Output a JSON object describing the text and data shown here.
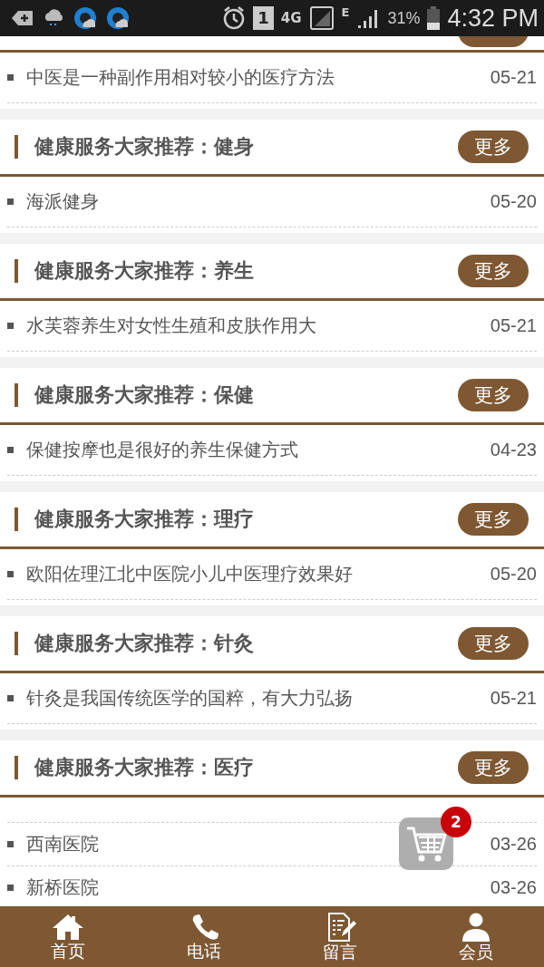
{
  "status_bar": {
    "sim": "1",
    "network": "4G",
    "roaming": "E",
    "battery": "31%",
    "time": "4:32 PM"
  },
  "top_items": [
    {
      "title": "中医是一种副作用相对较小的医疗方法",
      "date": "05-21"
    }
  ],
  "sections": [
    {
      "title": "健康服务大家推荐：健身",
      "more": "更多",
      "leading_blank": false,
      "items": [
        {
          "title": "海派健身",
          "date": "05-20"
        }
      ]
    },
    {
      "title": "健康服务大家推荐：养生",
      "more": "更多",
      "leading_blank": false,
      "items": [
        {
          "title": "水芙蓉养生对女性生殖和皮肤作用大",
          "date": "05-21"
        }
      ]
    },
    {
      "title": "健康服务大家推荐：保健",
      "more": "更多",
      "leading_blank": false,
      "items": [
        {
          "title": "保健按摩也是很好的养生保健方式",
          "date": "04-23"
        }
      ]
    },
    {
      "title": "健康服务大家推荐：理疗",
      "more": "更多",
      "leading_blank": false,
      "items": [
        {
          "title": "欧阳佐理江北中医院小儿中医理疗效果好",
          "date": "05-20"
        }
      ]
    },
    {
      "title": "健康服务大家推荐：针灸",
      "more": "更多",
      "leading_blank": false,
      "items": [
        {
          "title": "针灸是我国传统医学的国粹，有大力弘扬",
          "date": "05-21"
        }
      ]
    },
    {
      "title": "健康服务大家推荐：医疗",
      "more": "更多",
      "leading_blank": true,
      "items": [
        {
          "title": "西南医院",
          "date": "03-26"
        },
        {
          "title": "新桥医院",
          "date": "03-26"
        }
      ]
    }
  ],
  "cart": {
    "badge": "2"
  },
  "nav": [
    {
      "kind": "home",
      "label": "首页"
    },
    {
      "kind": "phone",
      "label": "电话"
    },
    {
      "kind": "message",
      "label": "留言"
    },
    {
      "kind": "member",
      "label": "会员"
    }
  ]
}
